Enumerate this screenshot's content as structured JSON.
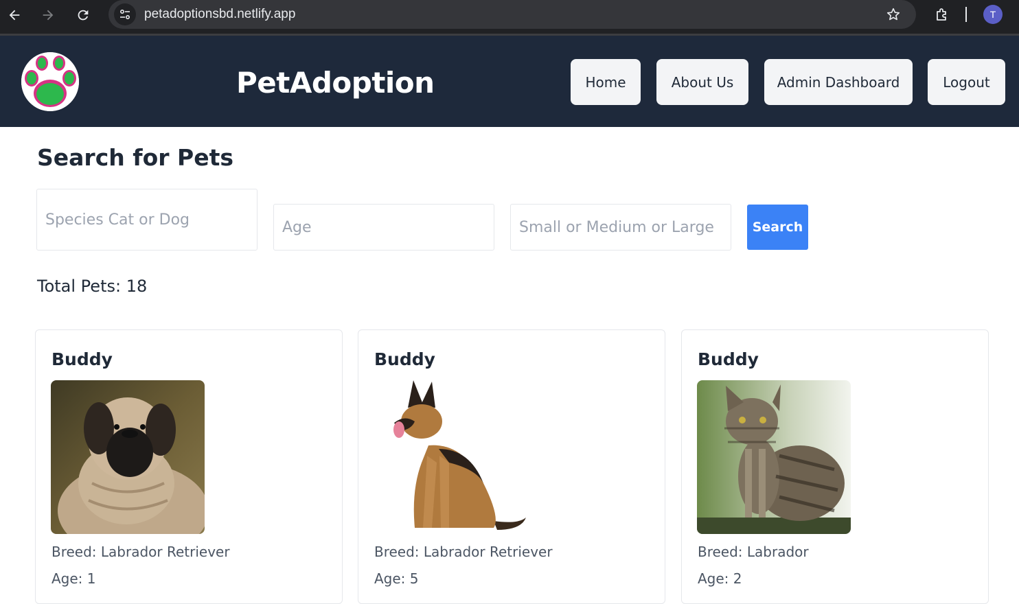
{
  "browser": {
    "url": "petadoptionsbd.netlify.app",
    "profile_initial": "T"
  },
  "navbar": {
    "brand": "PetAdoption",
    "links": [
      {
        "label": "Home"
      },
      {
        "label": "About Us"
      },
      {
        "label": "Admin Dashboard"
      },
      {
        "label": "Logout"
      }
    ]
  },
  "search": {
    "heading": "Search for Pets",
    "species_placeholder": "Species Cat or Dog",
    "age_placeholder": "Age",
    "size_placeholder": "Small or Medium or Large",
    "button_label": "Search"
  },
  "total_pets": "Total Pets: 18",
  "pets": [
    {
      "name": "Buddy",
      "breed": "Breed: Labrador Retriever",
      "age": "Age: 1",
      "photo": "mastiff-dog-photo"
    },
    {
      "name": "Buddy",
      "breed": "Breed: Labrador Retriever",
      "age": "Age: 5",
      "photo": "german-shepherd-dog-photo"
    },
    {
      "name": "Buddy",
      "breed": "Breed: Labrador",
      "age": "Age: 2",
      "photo": "tabby-cat-photo"
    }
  ],
  "colors": {
    "chrome_bg": "#202124",
    "navbar_bg": "#1e293b",
    "nav_button_bg": "#f3f4f6",
    "search_button_bg": "#3b82f6",
    "text_dark": "#1f2937"
  },
  "icons": [
    "back-arrow-icon",
    "forward-arrow-icon",
    "reload-icon",
    "site-info-icon",
    "bookmark-star-icon",
    "extensions-icon",
    "paw-logo-icon"
  ]
}
